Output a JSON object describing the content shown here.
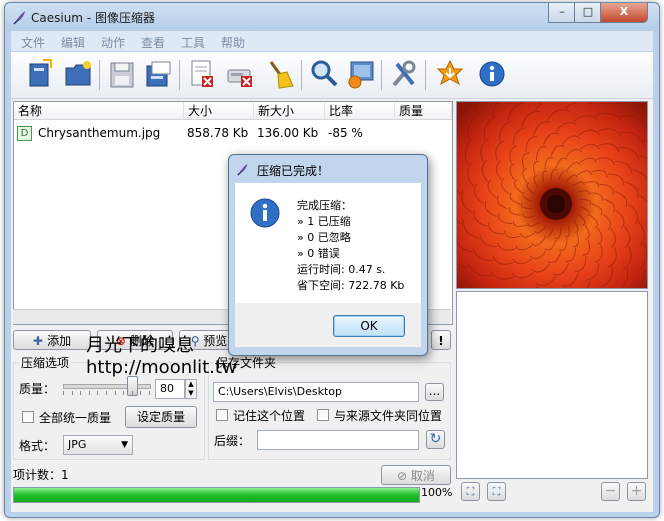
{
  "window": {
    "title": "Caesium - 图像压缩器",
    "minimize": "–",
    "maximize": "□",
    "close": "X"
  },
  "menu": [
    "文件",
    "编辑",
    "动作",
    "查看",
    "工具",
    "帮助"
  ],
  "toolbar": {
    "icons": [
      "open-file-icon",
      "open-folder-icon",
      "save-icon",
      "save-as-icon",
      "remove-icon",
      "clear-list-icon",
      "broom-icon",
      "preview-icon",
      "compress-icon",
      "settings-icon",
      "update-icon",
      "info-icon"
    ]
  },
  "list": {
    "headers": [
      "名称",
      "大小",
      "新大小",
      "比率",
      "质量"
    ],
    "rows": [
      {
        "icon": "D",
        "name": "Chrysanthemum.jpg",
        "size": "858.78 Kb",
        "new_size": "136.00 Kb",
        "ratio": "-85 %",
        "quality": ""
      }
    ]
  },
  "buttons": {
    "add": "添加",
    "remove": "删除",
    "preview": "预览",
    "exclaim": "!"
  },
  "compression": {
    "group_label": "压缩选项",
    "quality_label": "质量：",
    "quality_value": "80",
    "quality_level": 0.8,
    "same_quality_label": "全部统一质量",
    "set_quality_button": "设定质量",
    "format_label": "格式：",
    "format_value": "JPG"
  },
  "output": {
    "group_label": "保存文件夹",
    "path": "C:\\Users\\Elvis\\Desktop",
    "browse": "...",
    "remember_label": "记住这个位置",
    "same_as_source_label": "与来源文件夹同位置",
    "suffix_label": "后缀："
  },
  "status": {
    "item_count": "项计数：1",
    "cancel": "取消",
    "progress_text": "100%",
    "progress": 1.0
  },
  "dialog": {
    "title": "压缩已完成！",
    "lines": [
      "完成压缩：",
      "» 1 已压缩",
      "» 0 已忽略",
      "» 0 错误",
      "运行时间: 0.47 s.",
      "省下空间: 722.78 Kb"
    ],
    "ok": "OK"
  },
  "watermark": {
    "line1": "月光下的嗅息",
    "line2": "http://moonlit.tw"
  },
  "colors": {
    "progress": "#1fbe2a",
    "accent": "#3a68a8"
  }
}
